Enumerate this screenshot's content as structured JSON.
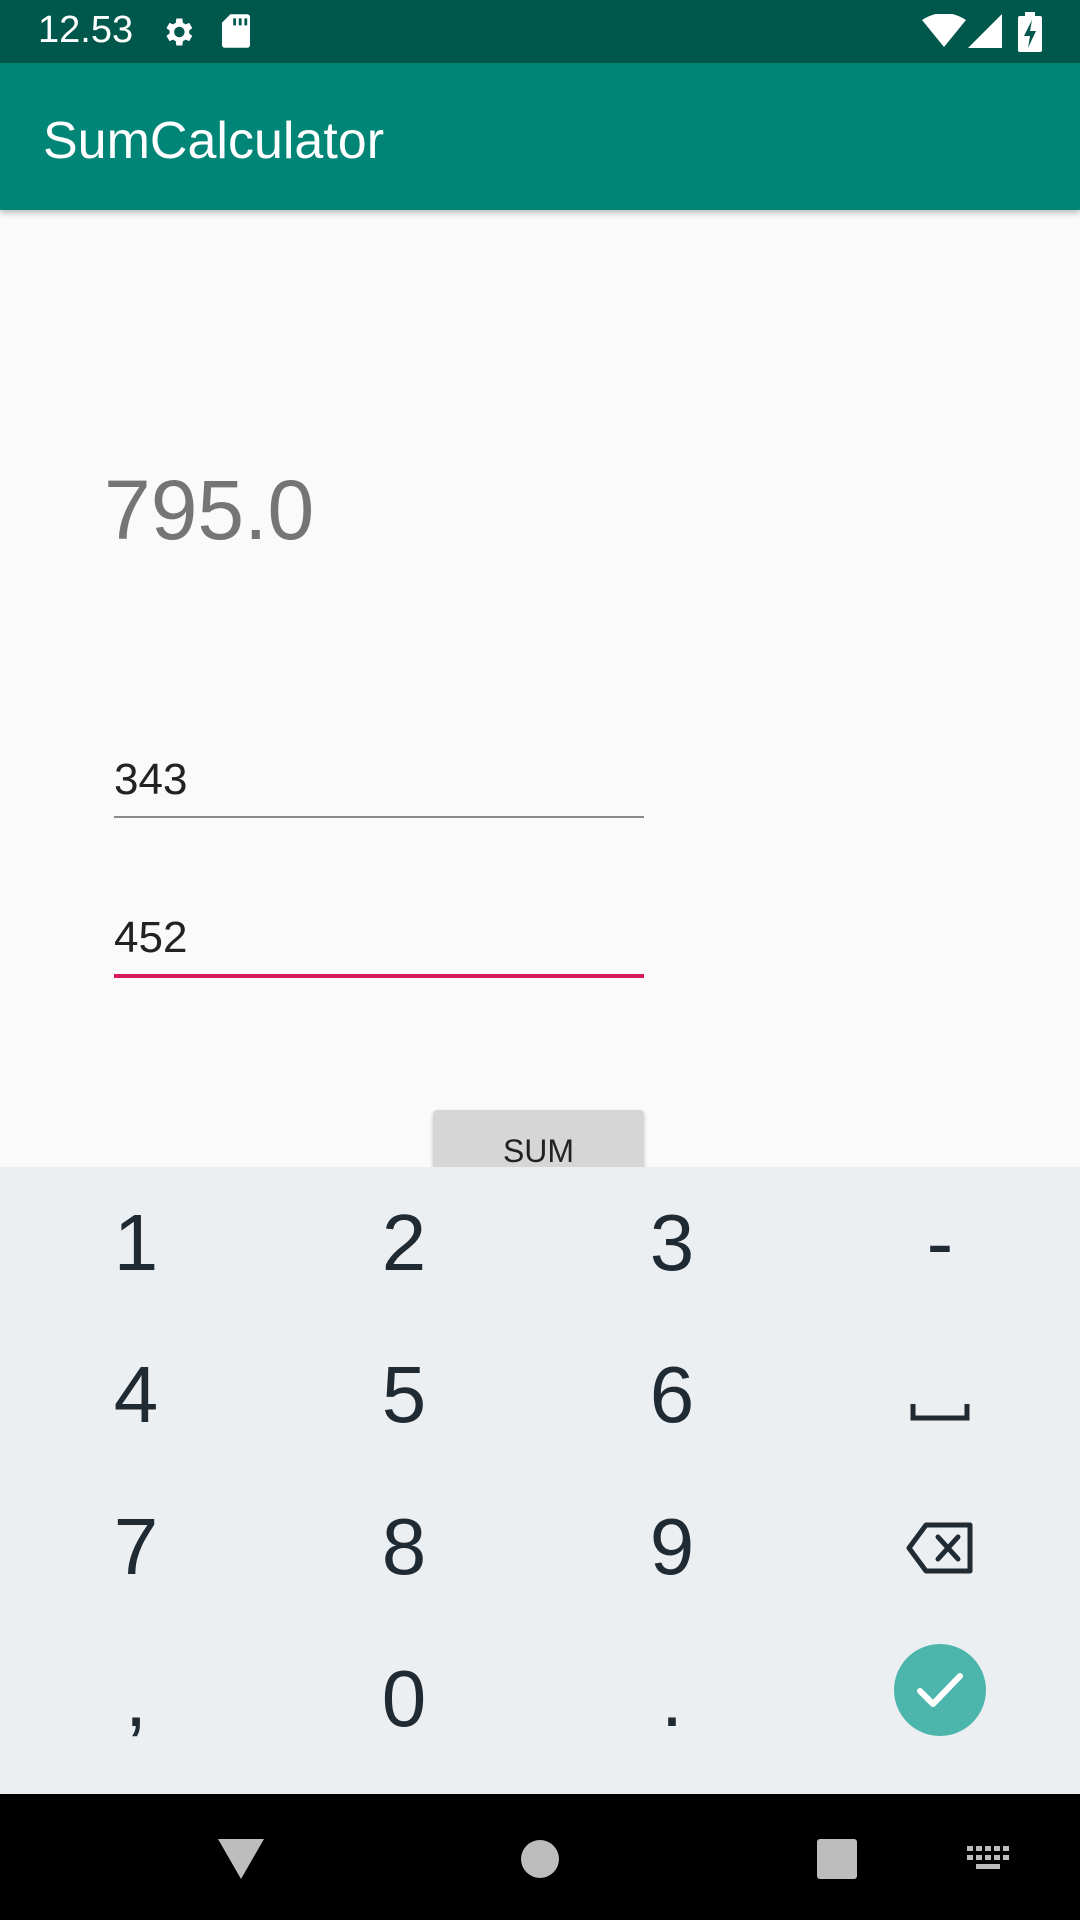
{
  "status_bar": {
    "time": "12.53",
    "icons": [
      "settings-icon",
      "sd-card-icon",
      "wifi-icon",
      "cell-signal-icon",
      "battery-charging-icon"
    ]
  },
  "app_bar": {
    "title": "SumCalculator"
  },
  "main": {
    "result": "795.0",
    "input_one": {
      "value": "343"
    },
    "input_two": {
      "value": "452"
    },
    "sum_button_label": "SUM"
  },
  "keyboard": {
    "rows": [
      [
        "1",
        "2",
        "3",
        "-"
      ],
      [
        "4",
        "5",
        "6",
        "space-icon"
      ],
      [
        "7",
        "8",
        "9",
        "backspace-icon"
      ],
      [
        ",",
        "0",
        ".",
        "done-check-icon"
      ]
    ]
  },
  "nav_bar": {
    "icons": [
      "back-icon",
      "home-icon",
      "recents-icon",
      "keyboard-switch-icon"
    ]
  },
  "colors": {
    "status_bar": "#00574b",
    "app_bar": "#008577",
    "focused_underline": "#d81b60",
    "done_button": "#4db6ac",
    "keyboard_bg": "#eceff2"
  }
}
